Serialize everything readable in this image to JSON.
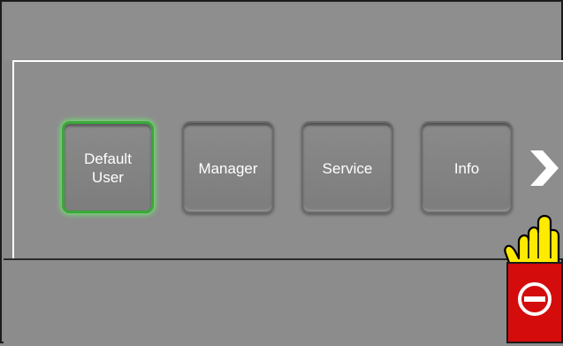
{
  "users": [
    {
      "label": "Default\nUser",
      "selected": true
    },
    {
      "label": "Manager",
      "selected": false
    },
    {
      "label": "Service",
      "selected": false
    },
    {
      "label": "Info",
      "selected": false
    }
  ],
  "icons": {
    "next": "chevron-right-icon",
    "pointer": "pointing-hand-icon",
    "stop": "no-entry-icon"
  },
  "colors": {
    "background": "#8c8c8c",
    "selected_glow": "#39a838",
    "stop_button": "#d40c0c",
    "hand": "#ffea00"
  }
}
